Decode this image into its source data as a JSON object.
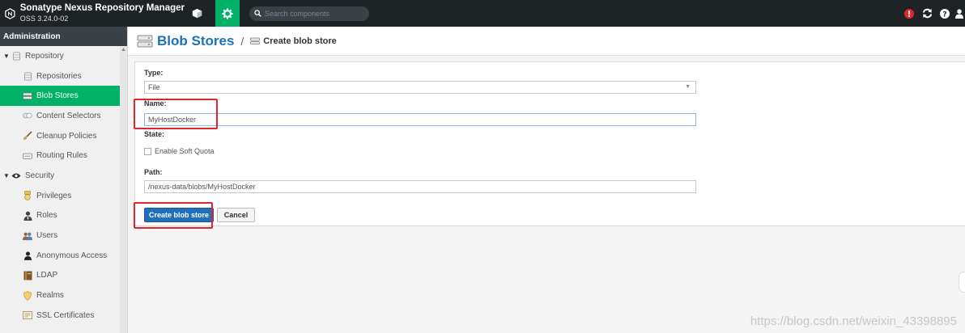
{
  "app": {
    "name": "Sonatype Nexus Repository Manager",
    "version": "OSS 3.24.0-02"
  },
  "header": {
    "search_placeholder": "Search components",
    "icons": [
      "cube-icon",
      "gear-icon",
      "alert-icon",
      "refresh-icon",
      "help-icon",
      "user-icon"
    ],
    "accent_color": "#00b267"
  },
  "sidebar": {
    "heading": "Administration",
    "groups": [
      {
        "label": "Repository",
        "icon": "database-icon",
        "items": [
          {
            "label": "Repositories",
            "icon": "database-icon"
          },
          {
            "label": "Blob Stores",
            "icon": "storage-icon",
            "selected": true
          },
          {
            "label": "Content Selectors",
            "icon": "layers-icon"
          },
          {
            "label": "Cleanup Policies",
            "icon": "brush-icon"
          },
          {
            "label": "Routing Rules",
            "icon": "route-icon"
          }
        ]
      },
      {
        "label": "Security",
        "icon": "eye-icon",
        "items": [
          {
            "label": "Privileges",
            "icon": "medal-icon"
          },
          {
            "label": "Roles",
            "icon": "user-tie-icon"
          },
          {
            "label": "Users",
            "icon": "users-icon"
          },
          {
            "label": "Anonymous Access",
            "icon": "user-icon"
          },
          {
            "label": "LDAP",
            "icon": "book-icon"
          },
          {
            "label": "Realms",
            "icon": "shield-icon"
          },
          {
            "label": "SSL Certificates",
            "icon": "certificate-icon"
          }
        ]
      }
    ]
  },
  "breadcrumb": {
    "main": "Blob Stores",
    "separator": "/",
    "sub": "Create blob store"
  },
  "form": {
    "type_label": "Type:",
    "type_value": "File",
    "name_label": "Name:",
    "name_value": "MyHostDocker",
    "state_label": "State:",
    "soft_quota_label": "Enable Soft Quota",
    "path_label": "Path:",
    "path_value": "/nexus-data/blobs/MyHostDocker",
    "create_button": "Create blob store",
    "cancel_button": "Cancel"
  },
  "watermark": "https://blog.csdn.net/weixin_43398895",
  "colors": {
    "highlight": "#e0262a",
    "primary_button": "#1f6fbd",
    "link": "#1a73ba"
  }
}
